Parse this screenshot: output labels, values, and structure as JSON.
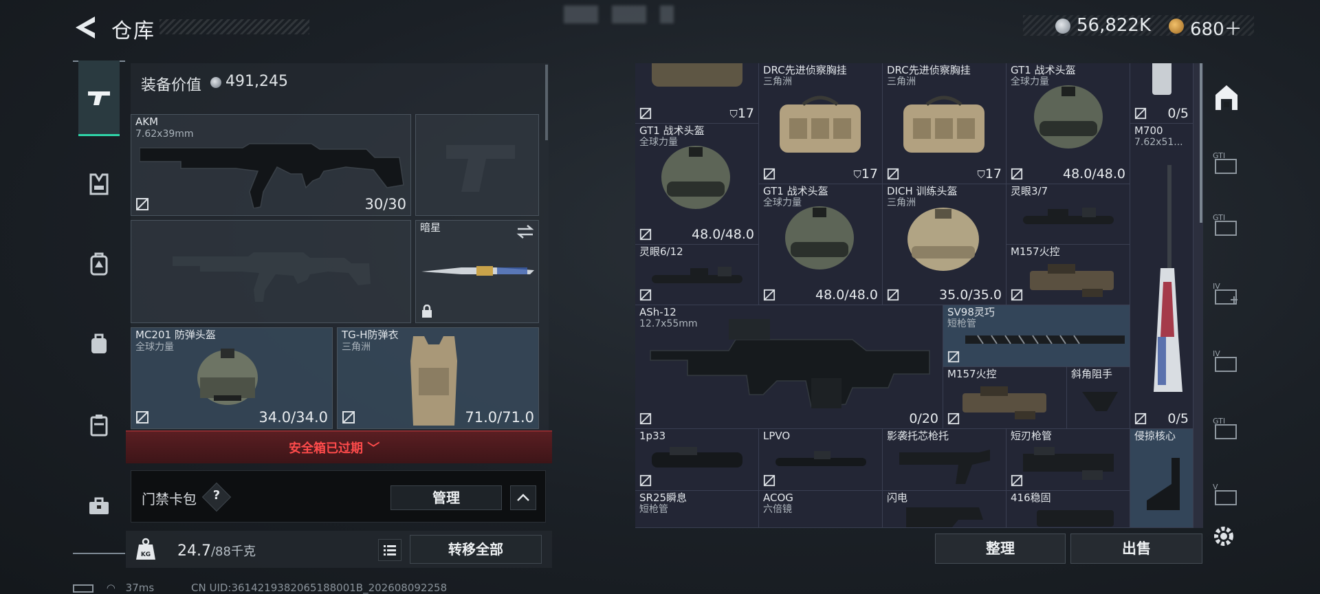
{
  "header": {
    "title": "仓库",
    "currency_primary": "56,822K",
    "currency_secondary": "680＋"
  },
  "equipment": {
    "value_label": "装备价值",
    "value": "491,245",
    "primary_weapon": {
      "name": "AKM",
      "caliber": "7.62x39mm",
      "ammo": "30/30"
    },
    "melee": {
      "name": "暗星"
    },
    "helmet": {
      "name": "MC201 防弹头盔",
      "faction": "全球力量",
      "durability": "34.0/34.0"
    },
    "armor": {
      "name": "TG-H防弹衣",
      "faction": "三角洲",
      "durability": "71.0/71.0"
    },
    "safebox_status": "安全箱已过期",
    "keycard_label": "门禁卡包",
    "keycard_help": "?",
    "manage_label": "管理",
    "weight_current": "24.7",
    "weight_max": "/88千克",
    "transfer_all_label": "转移全部"
  },
  "storage": {
    "cells": [
      {
        "id": "bag-top",
        "name": "",
        "sub": "",
        "dur": "17",
        "stack": true
      },
      {
        "id": "drc-1",
        "name": "DRC先进侦察胸挂",
        "sub": "三角洲",
        "dur": "17",
        "stack": true
      },
      {
        "id": "drc-2",
        "name": "DRC先进侦察胸挂",
        "sub": "三角洲",
        "dur": "17",
        "stack": true
      },
      {
        "id": "gt1-top",
        "name": "GT1 战术头盔",
        "sub": "全球力量",
        "dur": "48.0/48.0"
      },
      {
        "id": "mag-top",
        "name": "",
        "sub": "",
        "dur": "0/5"
      },
      {
        "id": "gt1-a",
        "name": "GT1 战术头盔",
        "sub": "全球力量",
        "dur": "48.0/48.0"
      },
      {
        "id": "m700",
        "name": "M700",
        "sub": "7.62x51...",
        "dur": "0/5"
      },
      {
        "id": "gt1-b",
        "name": "GT1 战术头盔",
        "sub": "全球力量",
        "dur": "48.0/48.0"
      },
      {
        "id": "dich",
        "name": "DICH 训练头盔",
        "sub": "三角洲",
        "dur": "35.0/35.0"
      },
      {
        "id": "lingyan37",
        "name": "灵眼3/7",
        "sub": "",
        "dur": ""
      },
      {
        "id": "lingyan612",
        "name": "灵眼6/12",
        "sub": "",
        "dur": ""
      },
      {
        "id": "m157-a",
        "name": "M157火控",
        "sub": "",
        "dur": ""
      },
      {
        "id": "ash12",
        "name": "ASh-12",
        "sub": "12.7x55mm",
        "dur": "0/20"
      },
      {
        "id": "sv98",
        "name": "SV98灵巧",
        "sub": "短枪管",
        "dur": ""
      },
      {
        "id": "m157-b",
        "name": "M157火控",
        "sub": "",
        "dur": ""
      },
      {
        "id": "angled-grip",
        "name": "斜角阻手",
        "sub": "",
        "dur": ""
      },
      {
        "id": "1p33",
        "name": "1p33",
        "sub": "",
        "dur": ""
      },
      {
        "id": "lpvo",
        "name": "LPVO",
        "sub": "",
        "dur": ""
      },
      {
        "id": "shadow-stock",
        "name": "影袭托芯枪托",
        "sub": "",
        "dur": ""
      },
      {
        "id": "short-barrel",
        "name": "短刃枪管",
        "sub": "",
        "dur": ""
      },
      {
        "id": "raid-core",
        "name": "侵掠核心",
        "sub": "",
        "dur": ""
      },
      {
        "id": "sr25",
        "name": "SR25瞬息",
        "sub": "短枪管",
        "dur": ""
      },
      {
        "id": "acog",
        "name": "ACOG",
        "sub": "六倍镜",
        "dur": ""
      },
      {
        "id": "lightning",
        "name": "闪电",
        "sub": "",
        "dur": ""
      },
      {
        "id": "416-fixed",
        "name": "416稳固",
        "sub": "",
        "dur": ""
      }
    ],
    "sort_label": "整理",
    "sell_label": "出售"
  },
  "right_tabs": [
    "GTI",
    "GTI",
    "IV",
    "IV",
    "GTI",
    "V"
  ],
  "status": {
    "ping": "37ms",
    "uid": "CN UID:3614219382065188001B_202608092258"
  },
  "colors": {
    "accent": "#2fd4a8",
    "danger": "#ff4b4b",
    "slot_blue": "#3a4e60"
  }
}
